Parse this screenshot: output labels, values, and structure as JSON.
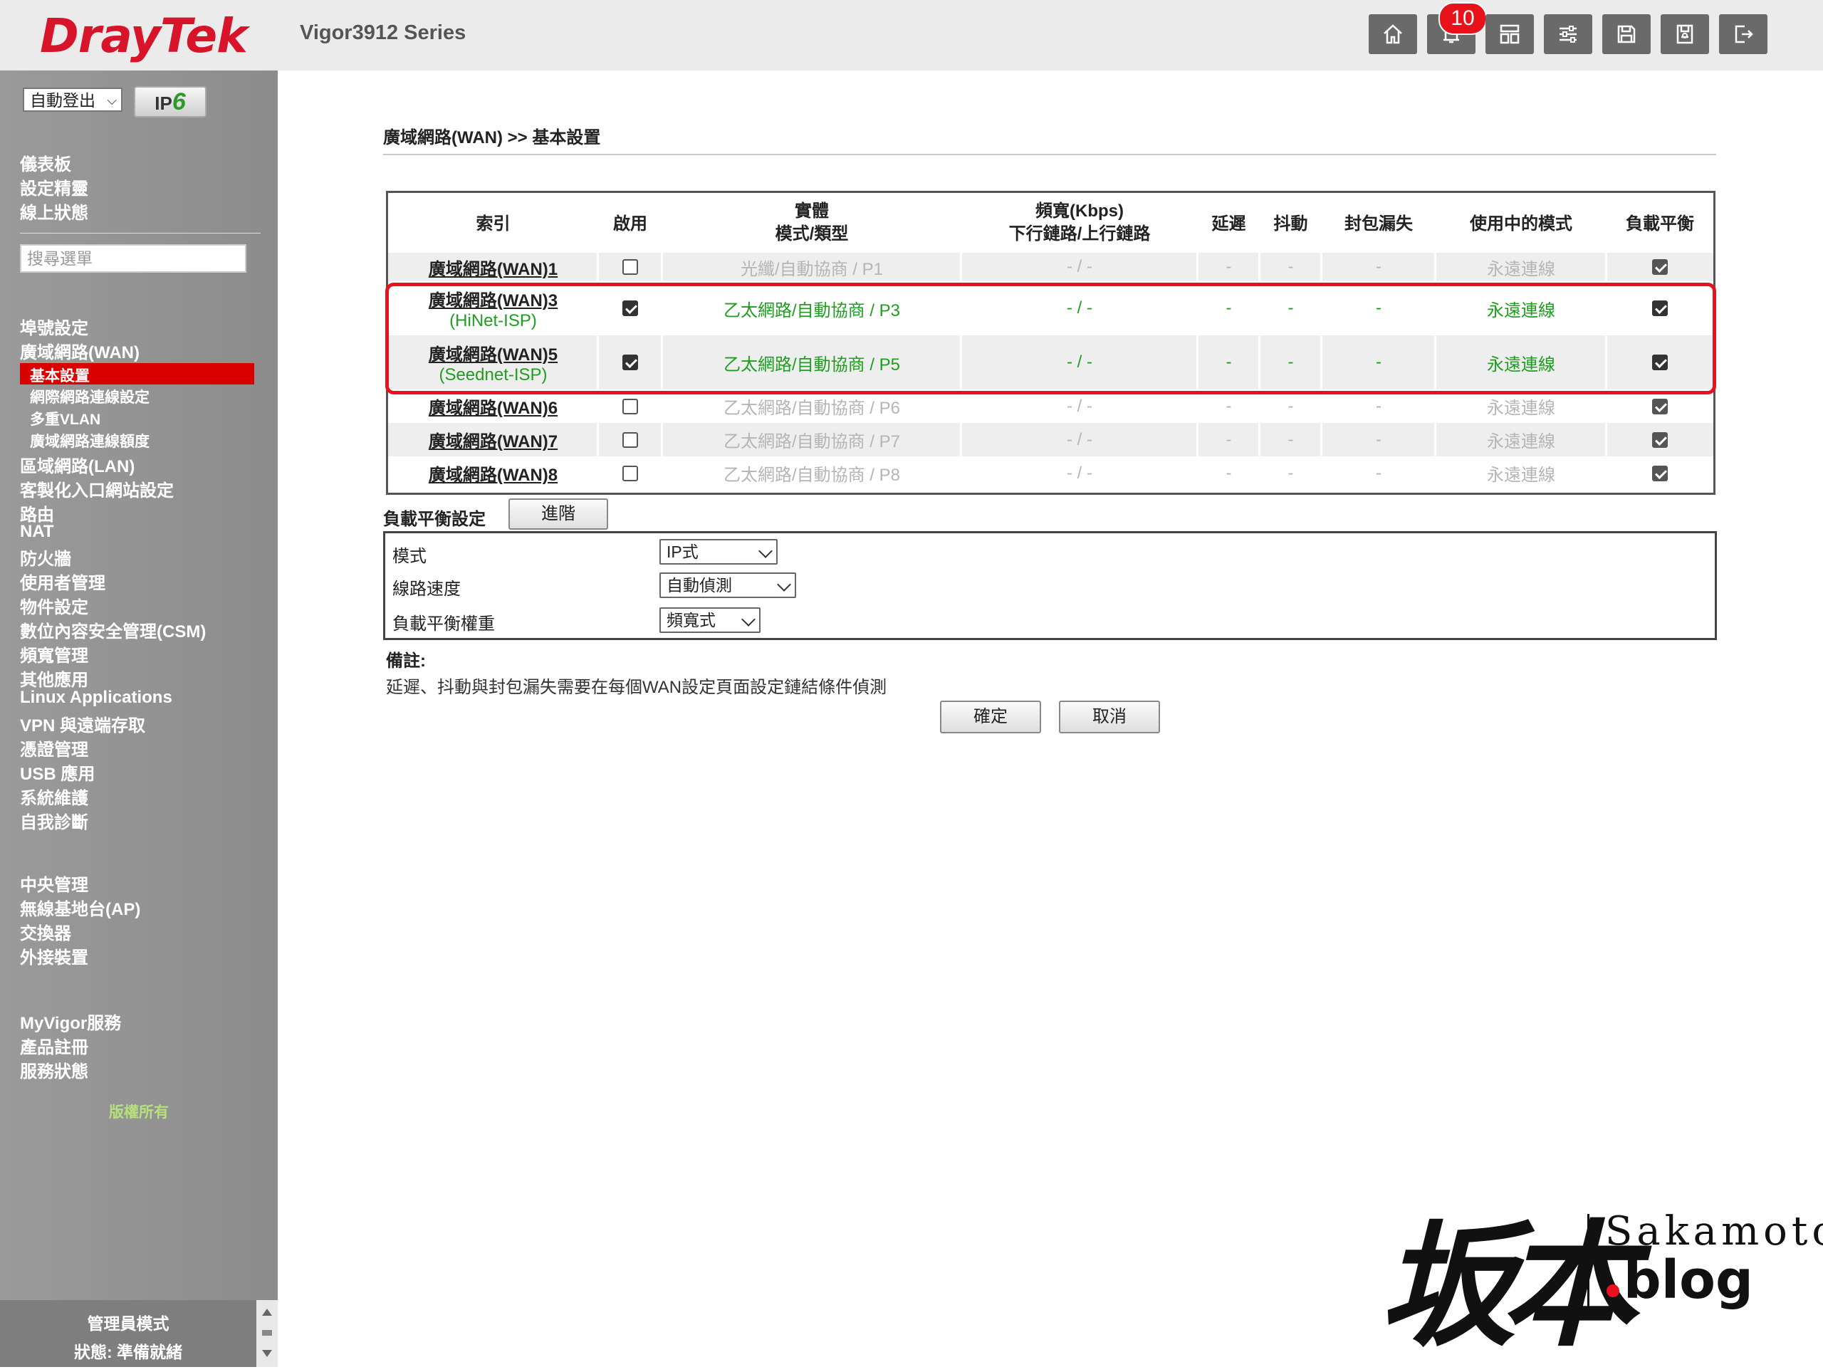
{
  "header": {
    "logo": "DrayTek",
    "model": "Vigor3912 Series",
    "notification_count": "10",
    "buttons": [
      "home-icon",
      "bell-icon",
      "dashboard-icon",
      "sliders-icon",
      "save-icon",
      "config-icon",
      "logout-icon"
    ]
  },
  "sidebar": {
    "logout_select": "自動登出",
    "ipv6_label": "IP",
    "ipv6_six": "6",
    "search_placeholder": "搜尋選單",
    "top_links": [
      "儀表板",
      "設定精靈",
      "線上狀態"
    ],
    "menu": [
      "埠號設定",
      "廣域網路(WAN)"
    ],
    "wan_sub_active": "基本設置",
    "wan_sub": [
      "網際網路連線設定",
      "多重VLAN",
      "廣域網路連線額度"
    ],
    "menu2": [
      "區域網路(LAN)",
      "客製化入口網站設定",
      "路由",
      "NAT",
      "防火牆",
      "使用者管理",
      "物件設定",
      "數位內容安全管理(CSM)",
      "頻寬管理",
      "其他應用",
      "Linux Applications",
      "VPN 與遠端存取",
      "憑證管理",
      "USB 應用",
      "系統維護",
      "自我診斷"
    ],
    "central": [
      "中央管理",
      "無線基地台(AP)",
      "交換器",
      "外接裝置"
    ],
    "myvigor": [
      "MyVigor服務",
      "產品註冊",
      "服務狀態"
    ],
    "copyright": "版權所有",
    "admin_mode": "管理員模式",
    "status": "狀態: 準備就緒"
  },
  "main": {
    "breadcrumb": "廣域網路(WAN) >> 基本設置",
    "headers": {
      "index": "索引",
      "enable": "啟用",
      "physical_1": "實體",
      "physical_2": "模式/類型",
      "bw_1": "頻寬(Kbps)",
      "bw_2": "下行鏈路/上行鏈路",
      "latency": "延遲",
      "jitter": "抖動",
      "loss": "封包漏失",
      "mode": "使用中的模式",
      "lb": "負載平衡"
    },
    "rows": [
      {
        "name": "廣域網路(WAN)1",
        "isp": "",
        "enabled": false,
        "physical": "光纖/自動協商 / P1",
        "bw": "- / -",
        "latency": "-",
        "jitter": "-",
        "loss": "-",
        "mode": "永遠連線",
        "lb": true
      },
      {
        "name": "廣域網路(WAN)3",
        "isp": "(HiNet-ISP)",
        "enabled": true,
        "physical": "乙太網路/自動協商 / P3",
        "bw": "- / -",
        "latency": "-",
        "jitter": "-",
        "loss": "-",
        "mode": "永遠連線",
        "lb": true
      },
      {
        "name": "廣域網路(WAN)5",
        "isp": "(Seednet-ISP)",
        "enabled": true,
        "physical": "乙太網路/自動協商 / P5",
        "bw": "- / -",
        "latency": "-",
        "jitter": "-",
        "loss": "-",
        "mode": "永遠連線",
        "lb": true
      },
      {
        "name": "廣域網路(WAN)6",
        "isp": "",
        "enabled": false,
        "physical": "乙太網路/自動協商 / P6",
        "bw": "- / -",
        "latency": "-",
        "jitter": "-",
        "loss": "-",
        "mode": "永遠連線",
        "lb": true
      },
      {
        "name": "廣域網路(WAN)7",
        "isp": "",
        "enabled": false,
        "physical": "乙太網路/自動協商 / P7",
        "bw": "- / -",
        "latency": "-",
        "jitter": "-",
        "loss": "-",
        "mode": "永遠連線",
        "lb": true
      },
      {
        "name": "廣域網路(WAN)8",
        "isp": "",
        "enabled": false,
        "physical": "乙太網路/自動協商 / P8",
        "bw": "- / -",
        "latency": "-",
        "jitter": "-",
        "loss": "-",
        "mode": "永遠連線",
        "lb": true
      }
    ],
    "lb_settings": {
      "label": "負載平衡設定",
      "advanced_button": "進階",
      "mode_label": "模式",
      "mode_value": "IP式",
      "speed_label": "線路速度",
      "speed_value": "自動偵測",
      "weight_label": "負載平衡權重",
      "weight_value": "頻寬式"
    },
    "note_title": "備註:",
    "note_text": "延遲、抖動與封包漏失需要在每個WAN設定頁面設定鏈結條件偵測",
    "ok_button": "確定",
    "cancel_button": "取消"
  },
  "watermark": {
    "kanji": "坂本",
    "sakamoto": "Sakamoto",
    "blog": "blog"
  },
  "colors": {
    "brand_red": "#d7142a",
    "enabled_green": "#1e9e1e",
    "highlight": "#e8111e"
  }
}
